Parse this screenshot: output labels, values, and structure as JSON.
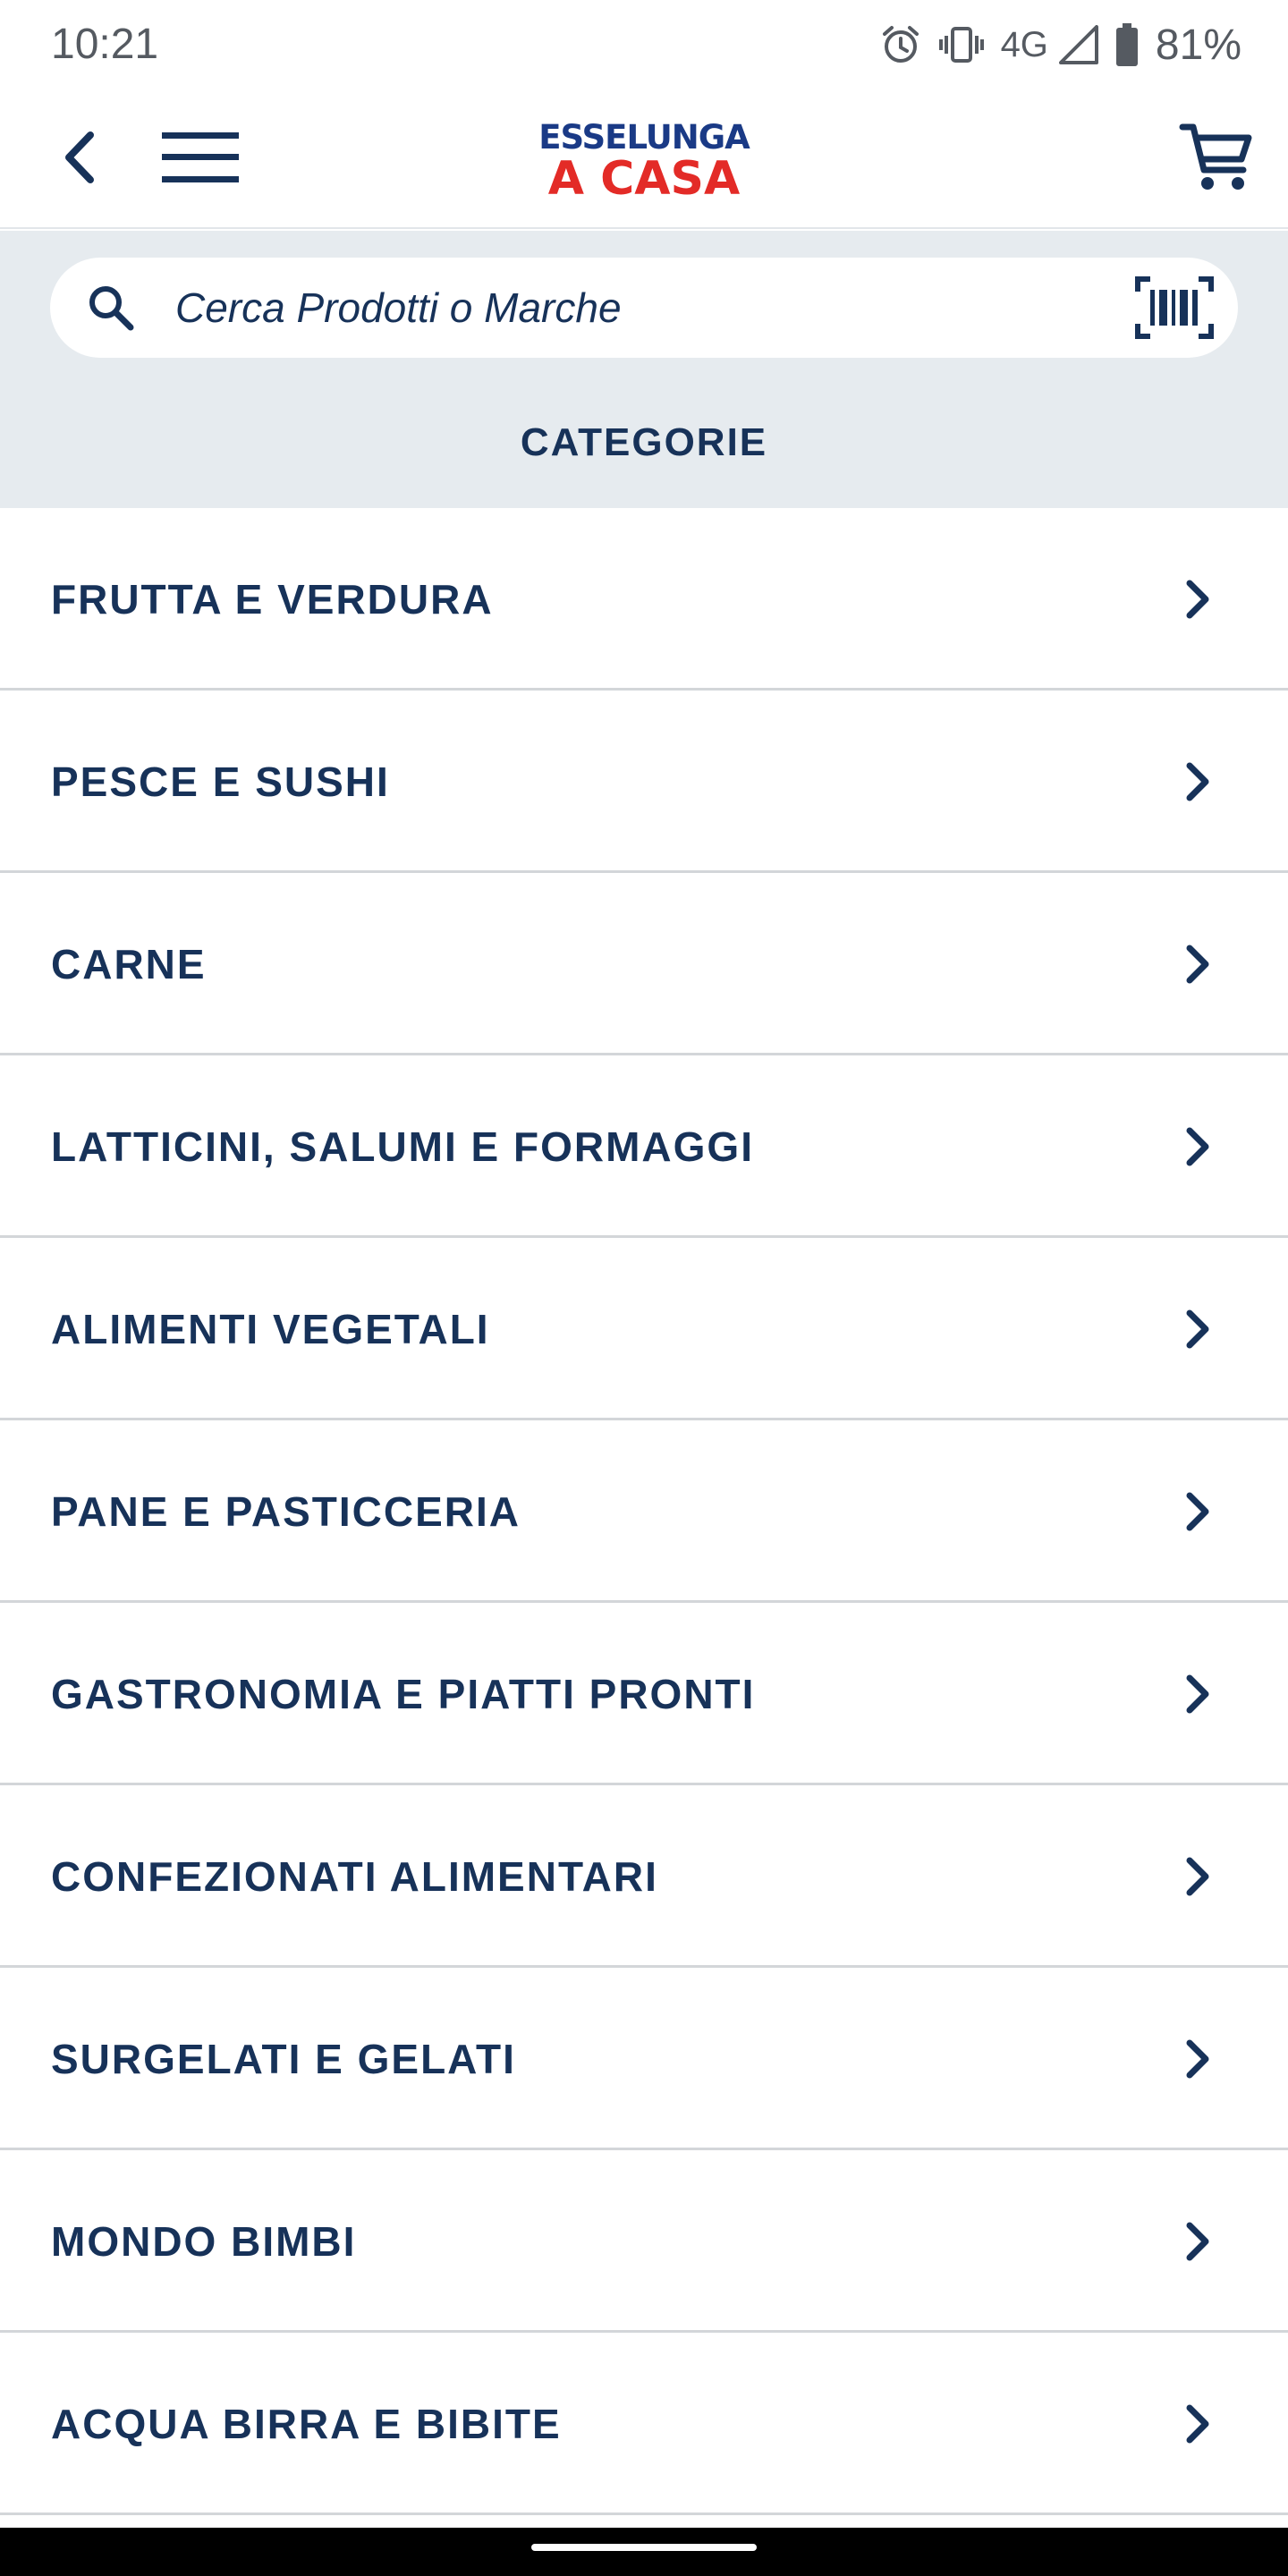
{
  "status_bar": {
    "time": "10:21",
    "network": "4G",
    "battery": "81%",
    "icons": [
      "alarm-icon",
      "vibrate-icon",
      "signal-icon",
      "battery-icon"
    ]
  },
  "app_bar": {
    "logo_top": "ESSELUNGA",
    "logo_bottom": "A CASA",
    "icons": [
      "back-arrow-icon",
      "hamburger-menu-icon",
      "cart-icon"
    ]
  },
  "search": {
    "placeholder": "Cerca Prodotti o Marche",
    "icons": [
      "search-icon",
      "barcode-scan-icon"
    ]
  },
  "section_title": "CATEGORIE",
  "categories": [
    {
      "label": "FRUTTA E VERDURA"
    },
    {
      "label": "PESCE E SUSHI"
    },
    {
      "label": "CARNE"
    },
    {
      "label": "LATTICINI, SALUMI E FORMAGGI"
    },
    {
      "label": "ALIMENTI VEGETALI"
    },
    {
      "label": "PANE E PASTICCERIA"
    },
    {
      "label": "GASTRONOMIA E PIATTI PRONTI"
    },
    {
      "label": "CONFEZIONATI ALIMENTARI"
    },
    {
      "label": "SURGELATI E GELATI"
    },
    {
      "label": "MONDO BIMBI"
    },
    {
      "label": "ACQUA BIRRA E BIBITE"
    }
  ],
  "colors": {
    "brand_navy": "#173259",
    "logo_blue": "#1a3a86",
    "logo_red": "#e32b27",
    "search_band": "#e6ebef",
    "divider": "#d3d6d9"
  }
}
